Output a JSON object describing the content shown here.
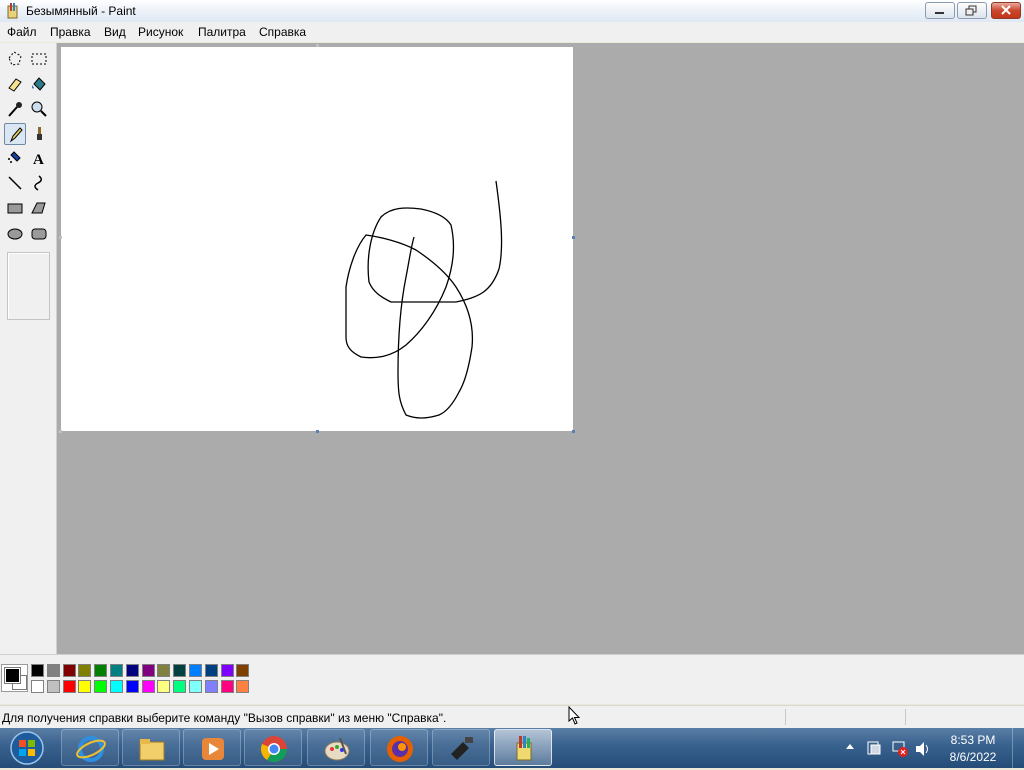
{
  "window": {
    "title": "Безымянный - Paint",
    "menu": [
      "Файл",
      "Правка",
      "Вид",
      "Рисунок",
      "Палитра",
      "Справка"
    ]
  },
  "tools": [
    {
      "name": "free-form-select-icon"
    },
    {
      "name": "rect-select-icon"
    },
    {
      "name": "eraser-icon"
    },
    {
      "name": "fill-bucket-icon"
    },
    {
      "name": "color-picker-icon"
    },
    {
      "name": "magnifier-icon"
    },
    {
      "name": "pencil-icon",
      "selected": true
    },
    {
      "name": "brush-icon"
    },
    {
      "name": "airbrush-icon"
    },
    {
      "name": "text-icon"
    },
    {
      "name": "line-icon"
    },
    {
      "name": "curve-icon"
    },
    {
      "name": "rectangle-icon"
    },
    {
      "name": "polygon-icon"
    },
    {
      "name": "ellipse-icon"
    },
    {
      "name": "rounded-rect-icon"
    }
  ],
  "palette": {
    "foreground": "#000000",
    "background": "#ffffff",
    "colors_top": [
      "#000000",
      "#808080",
      "#800000",
      "#808000",
      "#008000",
      "#008080",
      "#000080",
      "#800080",
      "#808040",
      "#004040",
      "#0080ff",
      "#004080",
      "#8000ff",
      "#804000"
    ],
    "colors_bottom": [
      "#ffffff",
      "#c0c0c0",
      "#ff0000",
      "#ffff00",
      "#00ff00",
      "#00ffff",
      "#0000ff",
      "#ff00ff",
      "#ffff80",
      "#00ff80",
      "#80ffff",
      "#8080ff",
      "#ff0080",
      "#ff8040"
    ]
  },
  "status": {
    "text": "Для получения справки выберите команду \"Вызов справки\" из меню \"Справка\"."
  },
  "taskbar": {
    "apps": [
      "internet-explorer-icon",
      "file-explorer-icon",
      "media-player-icon",
      "chrome-icon",
      "paint-shop-icon",
      "firefox-icon",
      "app-tool-icon",
      "paint-icon"
    ],
    "time": "8:53 PM",
    "date": "8/6/2022"
  }
}
